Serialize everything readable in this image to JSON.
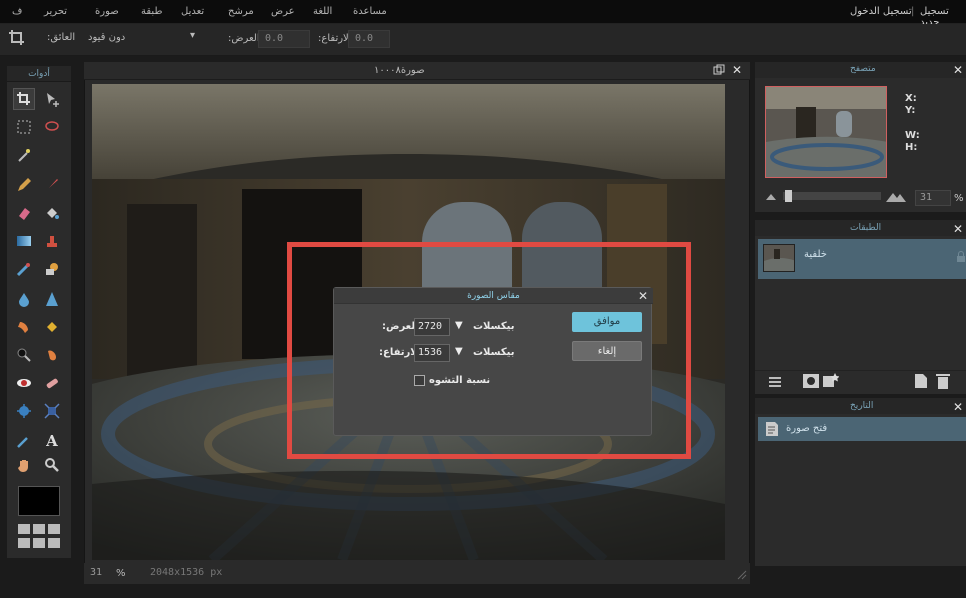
{
  "menubar": {
    "items": [
      "ف",
      "تحرير",
      "صورة",
      "طبقة",
      "تعديل",
      "مرشح",
      "عرض",
      "اللغة",
      "مساعدة"
    ],
    "auth": {
      "register": "تسجيل جديد",
      "separator": "|",
      "login": "تسجيل الدخول"
    }
  },
  "options": {
    "constraint": "دون قيود",
    "width_label": ":العرض",
    "width_value": "0.0",
    "height_label": ":الارتفاع",
    "height_value": "0.0"
  },
  "tools_panel": {
    "title": "أدوات"
  },
  "canvas": {
    "title": "صورة١٠٠٠٨",
    "zoom": "31",
    "zoom_unit": "%",
    "dims": "2048x1536 px"
  },
  "dialog": {
    "title": "مقاس الصورة",
    "width_value": "2720",
    "width_label": ":العرض",
    "height_value": "1536",
    "height_label": ":الارتفاع",
    "unit": "بيكسلات",
    "constrain_label": "نسبة التشوه",
    "ok_label": "موافق",
    "cancel_label": "إلغاء"
  },
  "navigator": {
    "title": "متصفح",
    "x_label": "X:",
    "y_label": "Y:",
    "w_label": "W:",
    "h_label": "H:",
    "zoom_value": "31",
    "zoom_unit": "%"
  },
  "layers": {
    "title": "الطبقات",
    "items": [
      "خلفية"
    ]
  },
  "history": {
    "title": "التاريخ",
    "items": [
      "فتح صورة"
    ]
  },
  "colors": {
    "accent": "#7aa3b7",
    "ok": "#6ec3db",
    "highlight": "#e04a42",
    "selection": "#4b6574"
  }
}
